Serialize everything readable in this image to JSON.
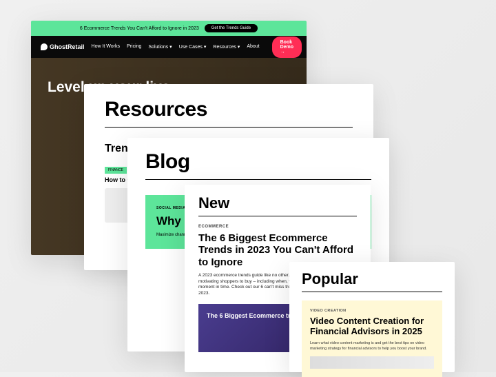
{
  "card1": {
    "topbar_text": "6 Ecommerce Trends You Can't Afford to Ignore in 2023",
    "topbar_cta": "Get the Trends Guide",
    "logo": "GhostRetail",
    "nav": [
      "How It Works",
      "Pricing",
      "Solutions ▾",
      "Use Cases ▾",
      "Resources ▾",
      "About"
    ],
    "demo": "Book Demo →",
    "hero": "Level up your live"
  },
  "card2": {
    "title": "Resources",
    "subtitle": "Trend",
    "mini": {
      "tag": "FINANCE",
      "title": "How to Conten Adviso"
    }
  },
  "card3": {
    "title": "Blog",
    "block": {
      "tag": "SOCIAL MEDIA",
      "title": "Why Enou Vide",
      "desc": "Maximize channel vi Discover t enhance y engagemen"
    }
  },
  "card4": {
    "title": "New",
    "tag": "ECOMMERCE",
    "article_title": "The 6 Biggest Ecommerce Trends in 2023 You Can't Afford to Ignore",
    "article_desc": "A 2023 ecommerce trends guide like no other. We're focused on what's motivating shoppers to buy – including when, where, and how – at this very moment in time. Check out our 6 can't miss trends you need to adapt to in 2023.",
    "img_text": "The 6 Biggest Ecommerce trends in 2023"
  },
  "card5": {
    "title": "Popular",
    "tag": "VIDEO CREATION",
    "article_title": "Video Content Creation for Financial Advisors in 2025",
    "article_desc": "Learn what video content marketing is and get the best tips on video marketing strategy for financial advisors to help you boost your brand."
  }
}
